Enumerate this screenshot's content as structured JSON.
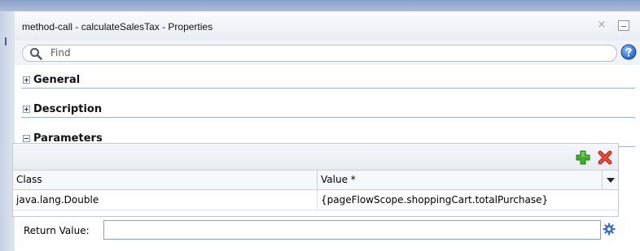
{
  "window": {
    "title": "method-call - calculateSalesTax - Properties",
    "close_glyph": "×"
  },
  "search": {
    "placeholder": "Find"
  },
  "sections": {
    "general": "General",
    "description": "Description",
    "parameters": "Parameters"
  },
  "parameters_table": {
    "columns": [
      "Class",
      "Value *"
    ],
    "rows": [
      {
        "class": "java.lang.Double",
        "value": "{pageFlowScope.shoppingCart.totalPurchase}"
      }
    ]
  },
  "return_value": {
    "label": "Return Value:",
    "value": ""
  },
  "icons": {
    "search": "search-icon",
    "help": "help-icon",
    "add": "add-icon",
    "delete": "delete-icon",
    "column_menu": "chevron-down-icon",
    "gear": "gear-icon",
    "expand": "plus-box-icon",
    "collapse": "minus-box-icon"
  },
  "colors": {
    "add": "#3fae2a",
    "delete": "#e0301e",
    "help": "#2f6fd1",
    "accent_border": "#9fb0c9"
  }
}
